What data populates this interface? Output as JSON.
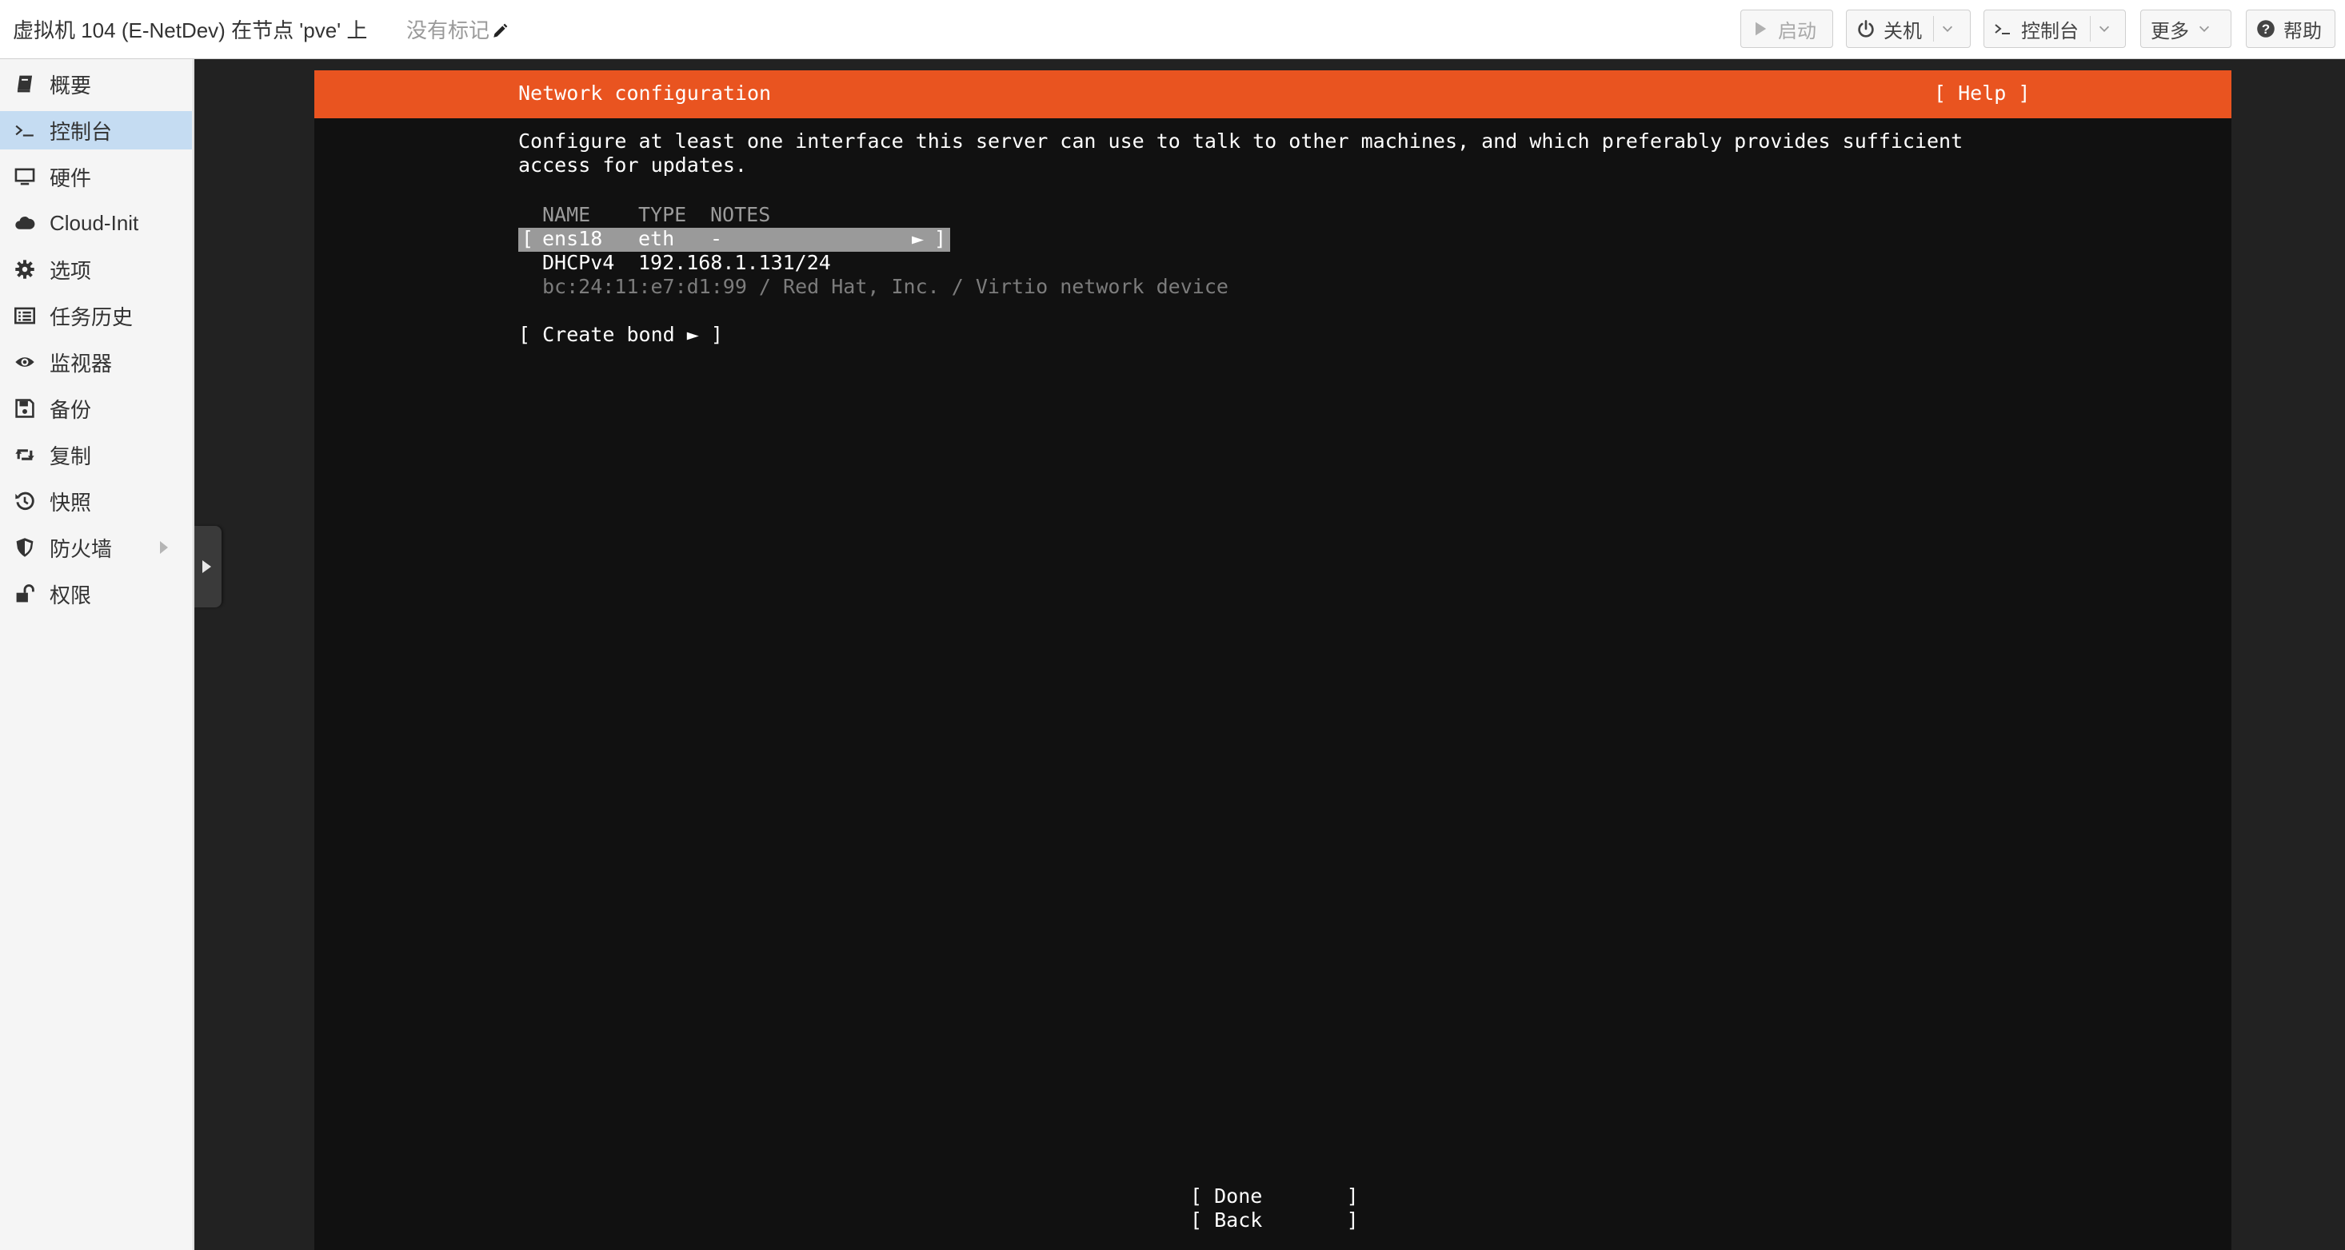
{
  "header": {
    "vm_title": "虚拟机 104 (E-NetDev) 在节点 'pve' 上",
    "tags_label": "没有标记",
    "buttons": {
      "start": "启动",
      "shutdown": "关机",
      "console": "控制台",
      "more": "更多",
      "help": "帮助"
    }
  },
  "sidebar": {
    "items": [
      {
        "label": "概要",
        "icon": "book-icon"
      },
      {
        "label": "控制台",
        "icon": "terminal-icon",
        "active": true
      },
      {
        "label": "硬件",
        "icon": "monitor-icon"
      },
      {
        "label": "Cloud-Init",
        "icon": "cloud-icon"
      },
      {
        "label": "选项",
        "icon": "gear-icon"
      },
      {
        "label": "任务历史",
        "icon": "list-icon"
      },
      {
        "label": "监视器",
        "icon": "eye-icon"
      },
      {
        "label": "备份",
        "icon": "floppy-icon"
      },
      {
        "label": "复制",
        "icon": "retweet-icon"
      },
      {
        "label": "快照",
        "icon": "history-icon"
      },
      {
        "label": "防火墙",
        "icon": "shield-icon",
        "has_submenu": true
      },
      {
        "label": "权限",
        "icon": "unlock-icon"
      }
    ]
  },
  "terminal": {
    "title": "Network configuration",
    "help": "[ Help ]",
    "description_line1": "Configure at least one interface this server can use to talk to other machines, and which preferably provides sufficient",
    "description_line2": "access for updates.",
    "columns": {
      "name": "NAME",
      "type": "TYPE",
      "notes": "NOTES"
    },
    "interface": {
      "bracket_open": "[",
      "name": "ens18",
      "type": "eth",
      "notes": "-",
      "arrow": "►",
      "bracket_close": "]"
    },
    "dhcp": {
      "label": "DHCPv4",
      "address": "192.168.1.131/24"
    },
    "mac_line": "bc:24:11:e7:d1:99 / Red Hat, Inc. / Virtio network device",
    "create_bond": "[ Create bond ► ]",
    "done": "[ Done       ]",
    "back": "[ Back       ]"
  },
  "colors": {
    "accent_orange": "#e95420",
    "active_nav": "#c5dcf2",
    "terminal_bg": "#111111",
    "selected_row": "#9a9a9a"
  }
}
